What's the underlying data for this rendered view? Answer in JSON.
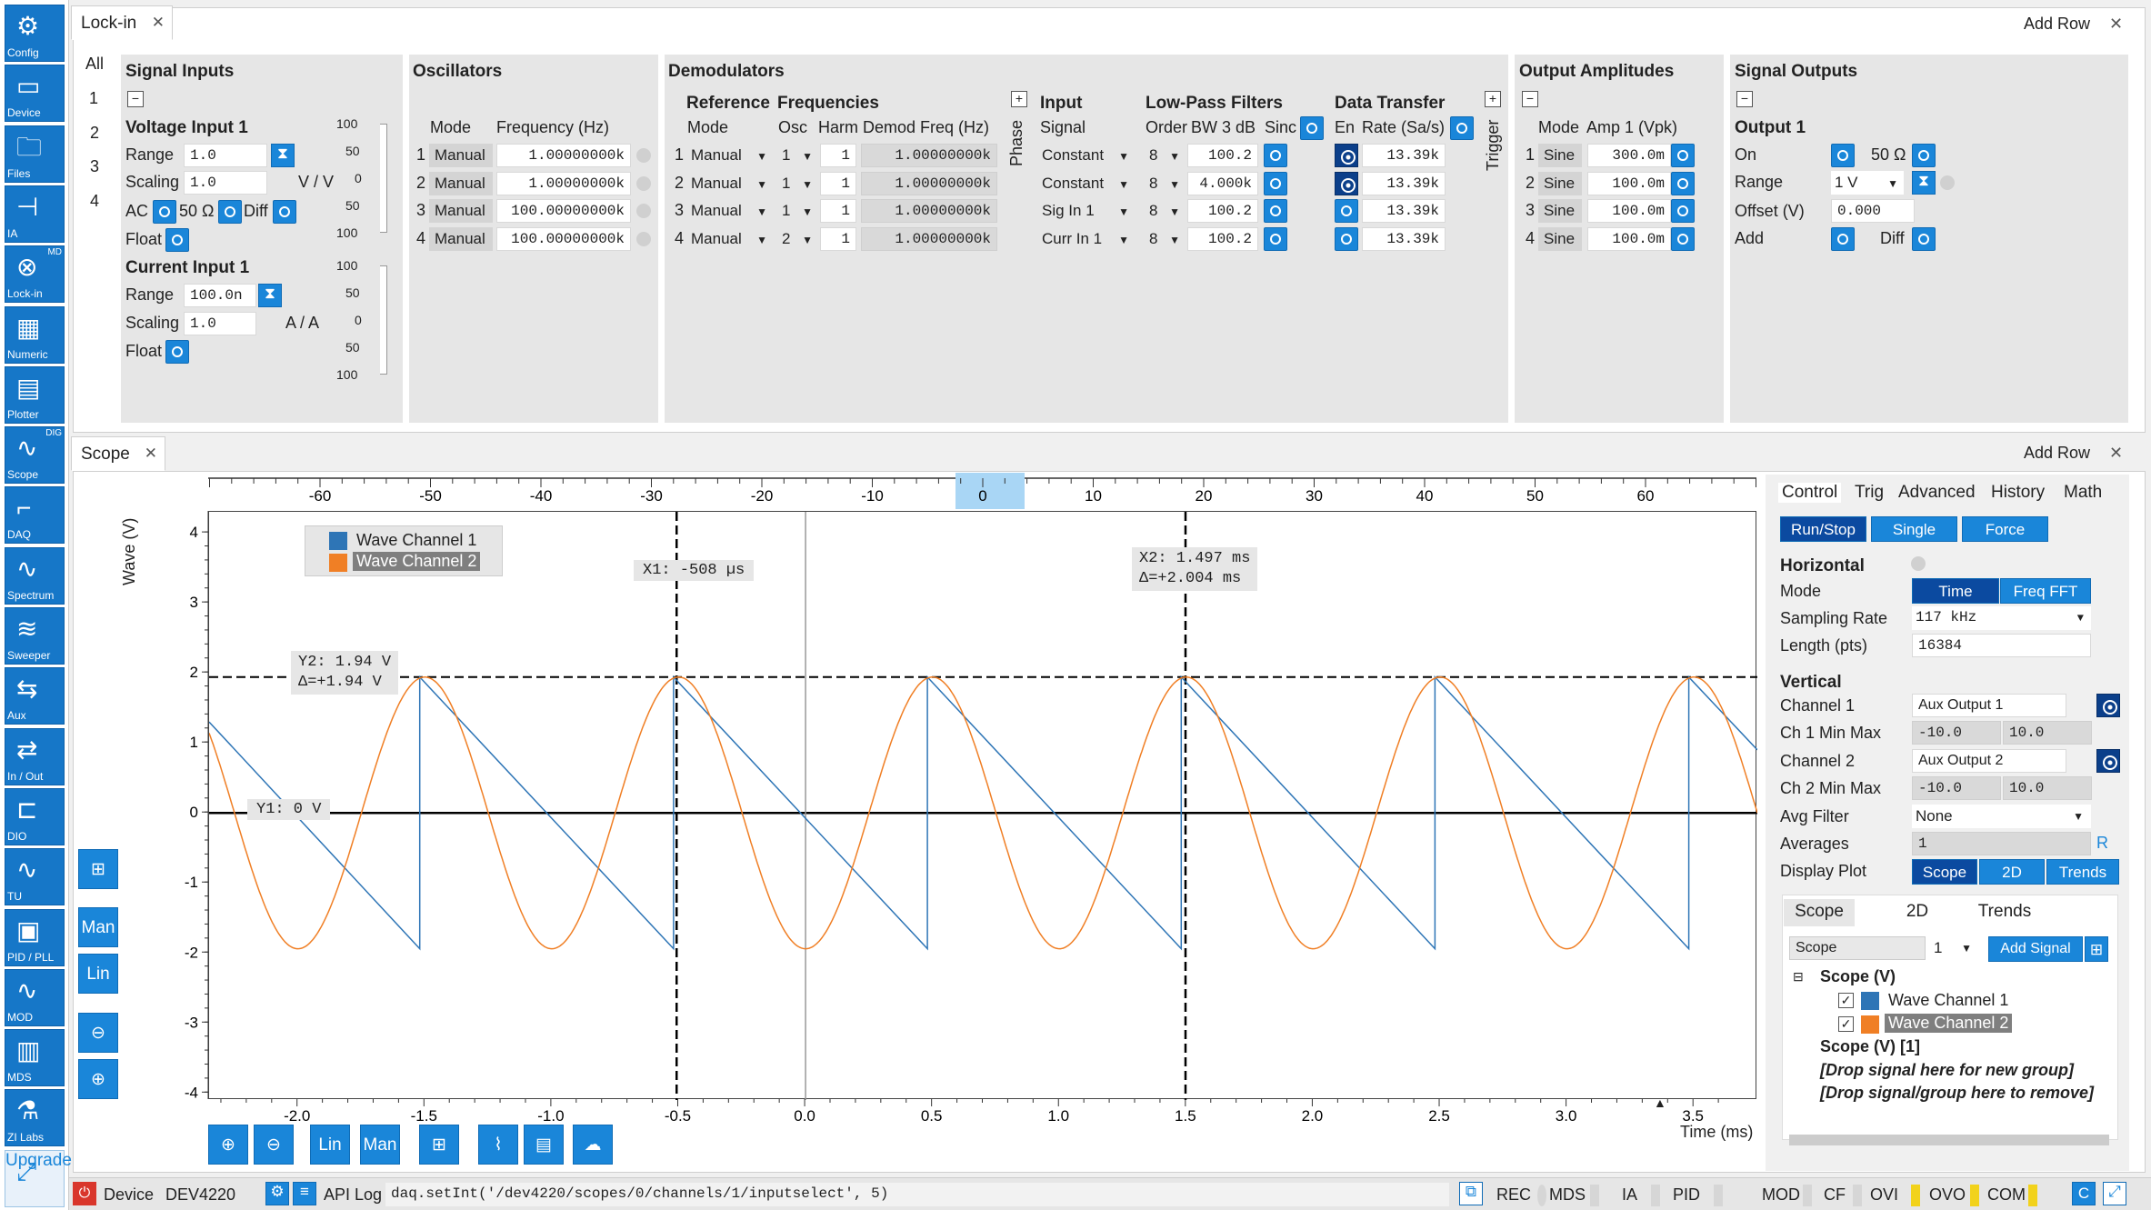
{
  "sidebar": [
    {
      "label": "Config",
      "icon": "gear-icon"
    },
    {
      "label": "Device",
      "icon": "device-icon"
    },
    {
      "label": "Files",
      "icon": "folder-icon"
    },
    {
      "label": "IA",
      "icon": "impedance-icon"
    },
    {
      "label": "Lock-in",
      "icon": "lockin-icon",
      "tag": "MD"
    },
    {
      "label": "Numeric",
      "icon": "numeric-icon"
    },
    {
      "label": "Plotter",
      "icon": "plotter-icon"
    },
    {
      "label": "Scope",
      "icon": "scope-icon",
      "tag": "DIG"
    },
    {
      "label": "DAQ",
      "icon": "daq-icon"
    },
    {
      "label": "Spectrum",
      "icon": "spectrum-icon"
    },
    {
      "label": "Sweeper",
      "icon": "sweeper-icon"
    },
    {
      "label": "Aux",
      "icon": "aux-icon"
    },
    {
      "label": "In / Out",
      "icon": "inout-icon"
    },
    {
      "label": "DIO",
      "icon": "dio-icon"
    },
    {
      "label": "TU",
      "icon": "tu-icon"
    },
    {
      "label": "PID / PLL",
      "icon": "pid-icon"
    },
    {
      "label": "MOD",
      "icon": "mod-icon"
    },
    {
      "label": "MDS",
      "icon": "mds-icon"
    },
    {
      "label": "ZI Labs",
      "icon": "flask-icon"
    },
    {
      "label": "Upgrade",
      "icon": "upgrade-icon"
    }
  ],
  "lockin": {
    "tab": "Lock-in",
    "add_row": "Add Row",
    "rows": [
      "All",
      "1",
      "2",
      "3",
      "4"
    ],
    "signal_inputs": {
      "title": "Signal Inputs",
      "voltage": "Voltage Input 1",
      "range_label": "Range",
      "range": "1.0",
      "scaling_label": "Scaling",
      "scaling": "1.0",
      "unit": "V / V",
      "ac": "AC",
      "ohm": "50 Ω",
      "diff": "Diff",
      "float": "Float",
      "current": "Current Input 1",
      "c_range": "100.0n",
      "c_scaling": "1.0",
      "c_unit": "A / A",
      "scale1": [
        "100",
        "50",
        "0",
        "50",
        "100"
      ],
      "scale2": [
        "100",
        "50",
        "0",
        "50",
        "100"
      ]
    },
    "oscillators": {
      "title": "Oscillators",
      "mode_h": "Mode",
      "freq_h": "Frequency (Hz)",
      "rows": [
        {
          "n": "1",
          "mode": "Manual",
          "freq": "1.00000000k"
        },
        {
          "n": "2",
          "mode": "Manual",
          "freq": "1.00000000k"
        },
        {
          "n": "3",
          "mode": "Manual",
          "freq": "100.00000000k"
        },
        {
          "n": "4",
          "mode": "Manual",
          "freq": "100.00000000k"
        }
      ]
    },
    "demods": {
      "title": "Demodulators",
      "ref": "Reference",
      "freqs": "Frequencies",
      "mode_h": "Mode",
      "osc_h": "Osc",
      "harm_h": "Harm",
      "demod_h": "Demod Freq (Hz)",
      "phase": "Phase",
      "input_h": "Input",
      "signal_h": "Signal",
      "lpf_h": "Low-Pass Filters",
      "order_h": "Order",
      "bw_h": "BW 3 dB",
      "sinc_h": "Sinc",
      "dt_h": "Data Transfer",
      "en_h": "En",
      "rate_h": "Rate (Sa/s)",
      "trigger": "Trigger",
      "rows": [
        {
          "n": "1",
          "mode": "Manual",
          "osc": "1",
          "harm": "1",
          "freq": "1.00000000k",
          "signal": "Constant",
          "order": "8",
          "bw": "100.2",
          "rate": "13.39k"
        },
        {
          "n": "2",
          "mode": "Manual",
          "osc": "1",
          "harm": "1",
          "freq": "1.00000000k",
          "signal": "Constant",
          "order": "8",
          "bw": "4.000k",
          "rate": "13.39k"
        },
        {
          "n": "3",
          "mode": "Manual",
          "osc": "1",
          "harm": "1",
          "freq": "1.00000000k",
          "signal": "Sig In 1",
          "order": "8",
          "bw": "100.2",
          "rate": "13.39k"
        },
        {
          "n": "4",
          "mode": "Manual",
          "osc": "2",
          "harm": "1",
          "freq": "1.00000000k",
          "signal": "Curr In 1",
          "order": "8",
          "bw": "100.2",
          "rate": "13.39k"
        }
      ]
    },
    "outamp": {
      "title": "Output Amplitudes",
      "mode_h": "Mode",
      "amp_h": "Amp 1 (Vpk)",
      "rows": [
        {
          "n": "1",
          "mode": "Sine",
          "amp": "300.0m"
        },
        {
          "n": "2",
          "mode": "Sine",
          "amp": "100.0m"
        },
        {
          "n": "3",
          "mode": "Sine",
          "amp": "100.0m"
        },
        {
          "n": "4",
          "mode": "Sine",
          "amp": "100.0m"
        }
      ]
    },
    "sigout": {
      "title": "Signal Outputs",
      "out": "Output 1",
      "on": "On",
      "ohm": "50 Ω",
      "range_l": "Range",
      "range": "1 V",
      "offset_l": "Offset (V)",
      "offset": "0.000",
      "add": "Add",
      "diff": "Diff"
    }
  },
  "scope": {
    "tab": "Scope",
    "add_row": "Add Row",
    "ylabel": "Wave (V)",
    "xlabel": "Time (ms)",
    "top_ticks": [
      "-60",
      "-50",
      "-40",
      "-30",
      "-20",
      "-10",
      "0",
      "10",
      "20",
      "30",
      "40",
      "50",
      "60"
    ],
    "legend": [
      "Wave Channel 1",
      "Wave Channel 2"
    ],
    "cursors": {
      "x1": "X1: -508 µs",
      "x2": "X2: 1.497 ms",
      "x2d": "Δ=+2.004 ms",
      "y1": "Y1: 0 V",
      "y2": "Y2: 1.94 V",
      "y2d": "Δ=+1.94 V"
    },
    "left_tools": [
      "Man",
      "Lin"
    ],
    "bottom_tools": [
      "Lin",
      "Man"
    ],
    "colors": {
      "ch1": "#2e75b6",
      "ch2": "#f07f25"
    }
  },
  "chart_data": {
    "type": "line",
    "xlabel": "Time (ms)",
    "ylabel": "Wave (V)",
    "xlim": [
      -2.35,
      3.75
    ],
    "ylim": [
      -4.1,
      4.3
    ],
    "xticks": [
      "-2.0",
      "-1.5",
      "-1.0",
      "-0.5",
      "0.0",
      "0.5",
      "1.0",
      "1.5",
      "2.0",
      "2.5",
      "3.0",
      "3.5"
    ],
    "yticks": [
      "4",
      "3",
      "2",
      "1",
      "0",
      "-1",
      "-2",
      "-3",
      "-4"
    ],
    "grid": false,
    "legend": "top-left",
    "series": [
      {
        "name": "Wave Channel 1",
        "shape": "sawtooth",
        "period_ms": 1.0,
        "min": -1.94,
        "max": 1.94,
        "x": [
          -2.35,
          -1.52,
          -1.52,
          -0.52,
          -0.52,
          0.48,
          0.48,
          1.48,
          1.48,
          2.48,
          2.48,
          3.48,
          3.48,
          3.75
        ],
        "y": [
          1.3,
          -1.94,
          1.94,
          -1.94,
          1.94,
          -1.94,
          1.94,
          -1.94,
          1.94,
          -1.94,
          1.94,
          -1.94,
          1.94,
          0.9
        ]
      },
      {
        "name": "Wave Channel 2",
        "shape": "sine",
        "period_ms": 1.0,
        "amplitude": 1.94,
        "x": [
          -2.0,
          -1.5,
          -1.0,
          -0.5,
          0.0,
          0.5,
          1.0,
          1.5,
          2.0,
          2.5,
          3.0,
          3.5
        ],
        "y": [
          -1.94,
          1.94,
          -1.94,
          1.94,
          -1.94,
          1.94,
          -1.94,
          1.94,
          -1.94,
          1.94,
          -1.94,
          1.94
        ]
      }
    ]
  },
  "control": {
    "tabs": [
      "Control",
      "Trig",
      "Advanced",
      "History",
      "Math"
    ],
    "runstop": "Run/Stop",
    "single": "Single",
    "force": "Force",
    "horizontal": "Horizontal",
    "mode_l": "Mode",
    "time": "Time",
    "fft": "Freq FFT",
    "sr_l": "Sampling Rate",
    "sr": "117 kHz",
    "len_l": "Length (pts)",
    "len": "16384",
    "vertical": "Vertical",
    "ch1_l": "Channel 1",
    "ch1": "Aux Output 1",
    "ch1mm_l": "Ch 1 Min Max",
    "ch1min": "-10.0",
    "ch1max": "10.0",
    "ch2_l": "Channel 2",
    "ch2": "Aux Output 2",
    "ch2mm_l": "Ch 2 Min Max",
    "ch2min": "-10.0",
    "ch2max": "10.0",
    "avg_l": "Avg Filter",
    "avg": "None",
    "averages_l": "Averages",
    "averages": "1",
    "r": "R",
    "dp_l": "Display Plot",
    "dp": [
      "Scope",
      "2D",
      "Trends"
    ],
    "subtabs": [
      "Scope",
      "2D",
      "Trends"
    ],
    "scope_sel": "Scope",
    "num": "1",
    "add_signal": "Add Signal",
    "tree": {
      "g1": "Scope (V)",
      "c1": "Wave Channel 1",
      "c2": "Wave Channel 2",
      "g2": "Scope (V) [1]",
      "drop1": "[Drop signal here for new group]",
      "drop2": "[Drop signal/group here to remove]"
    }
  },
  "status": {
    "device_l": "Device",
    "device": "DEV4220",
    "apilog": "API Log",
    "cmd": "daq.setInt('/dev4220/scopes/0/channels/1/inputselect', 5)",
    "items": [
      "REC",
      "MDS",
      "IA",
      "PID",
      "MOD",
      "CF",
      "OVI",
      "OVO",
      "COM"
    ],
    "c": "C"
  }
}
